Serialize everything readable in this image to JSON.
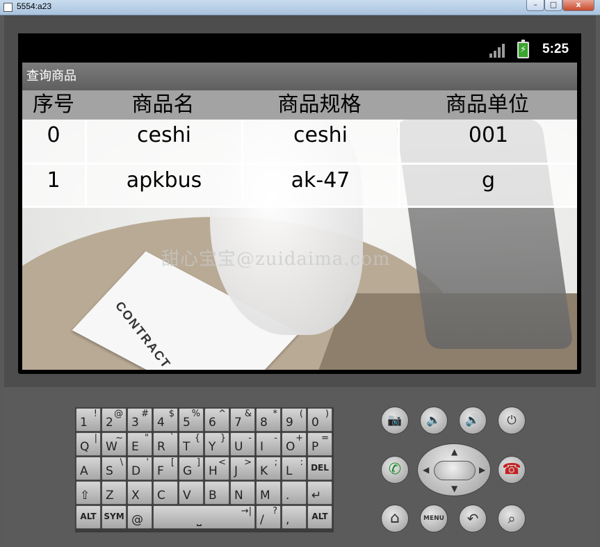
{
  "window": {
    "title": "5554:a23",
    "minimize": "–",
    "maximize": "□",
    "close": "x"
  },
  "status": {
    "time": "5:25"
  },
  "app": {
    "title": "查询商品",
    "columns": [
      "序号",
      "商品名",
      "商品规格",
      "商品单位"
    ],
    "rows": [
      {
        "id": "0",
        "name": "ceshi",
        "spec": "ceshi",
        "unit": "001"
      },
      {
        "id": "1",
        "name": "apkbus",
        "spec": "ak-47",
        "unit": "g"
      }
    ],
    "background": {
      "contract_text": "CONTRACT",
      "watermark": "甜心宝宝@zuidaima.com"
    }
  },
  "keyboard": {
    "row1": [
      [
        "1",
        "!"
      ],
      [
        "2",
        "@"
      ],
      [
        "3",
        "#"
      ],
      [
        "4",
        "$"
      ],
      [
        "5",
        "%"
      ],
      [
        "6",
        "^"
      ],
      [
        "7",
        "&"
      ],
      [
        "8",
        "*"
      ],
      [
        "9",
        "("
      ],
      [
        "0",
        ")"
      ]
    ],
    "row2": [
      [
        "Q",
        "|"
      ],
      [
        "W",
        "~"
      ],
      [
        "E",
        "\""
      ],
      [
        "R",
        "`"
      ],
      [
        "T",
        "{"
      ],
      [
        "Y",
        "}"
      ],
      [
        "U",
        "-"
      ],
      [
        "I",
        "-"
      ],
      [
        "O",
        "+"
      ],
      [
        "P",
        "="
      ]
    ],
    "row3": [
      [
        "A",
        ""
      ],
      [
        "S",
        "\\"
      ],
      [
        "D",
        "'"
      ],
      [
        "F",
        "["
      ],
      [
        "G",
        "]"
      ],
      [
        "H",
        "<"
      ],
      [
        "J",
        ">"
      ],
      [
        "K",
        ";"
      ],
      [
        "L",
        ":"
      ],
      [
        "DEL",
        ""
      ]
    ],
    "row4": [
      [
        "⇧",
        ""
      ],
      [
        "Z",
        ""
      ],
      [
        "X",
        ""
      ],
      [
        "C",
        ""
      ],
      [
        "V",
        ""
      ],
      [
        "B",
        ""
      ],
      [
        "N",
        ""
      ],
      [
        "M",
        ""
      ],
      [
        ".",
        ""
      ],
      [
        "↵",
        ""
      ]
    ],
    "row5": {
      "alt_left": "ALT",
      "sym": "SYM",
      "at": "@",
      "space": "⎵",
      "tab": "→|",
      "slash": "/",
      "question": "?",
      "comma": ",",
      "alt_right": "ALT"
    }
  },
  "hardware": {
    "camera": "📷",
    "vol_down": "🔈",
    "vol_up": "🔊",
    "power": "⏻",
    "call": "✆",
    "end_call": "☎",
    "home": "⌂",
    "menu": "MENU",
    "back": "↶",
    "search": "⌕"
  }
}
